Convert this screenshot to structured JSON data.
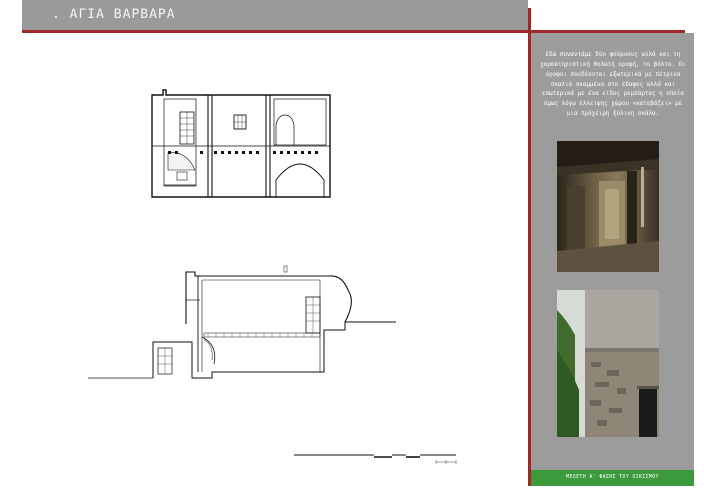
{
  "header": {
    "title": ". ΑΓΙΑ ΒΑΡΒΑΡΑ"
  },
  "side_panel": {
    "description": "Εδώ συναντάμε δύο φούρνους αλλά και τη χαρακτηριστική θολωτή οροφή, το βόλτο. Οι όροφοι συνδέονται εξωτερικά με πέτρινα σκαλιά σκαμμένα στο έδαφος αλλά και εσωτερικά με ένα είδος ρεμπάρτας η οποία όμως λόγω έλλειψης χώρου «κατεβάζει» με μια πρόχειρη ξύλινη σκάλα.",
    "footer_label": "ΜΕΛΕΤΗ Α' ΦΑΣΗΣ ΤΟΥ ΟΙΚΙΣΜΟΥ"
  },
  "colors": {
    "accent_red": "#a02828",
    "panel_gray": "#9c9c9c",
    "footer_green": "#3c9a3c"
  }
}
